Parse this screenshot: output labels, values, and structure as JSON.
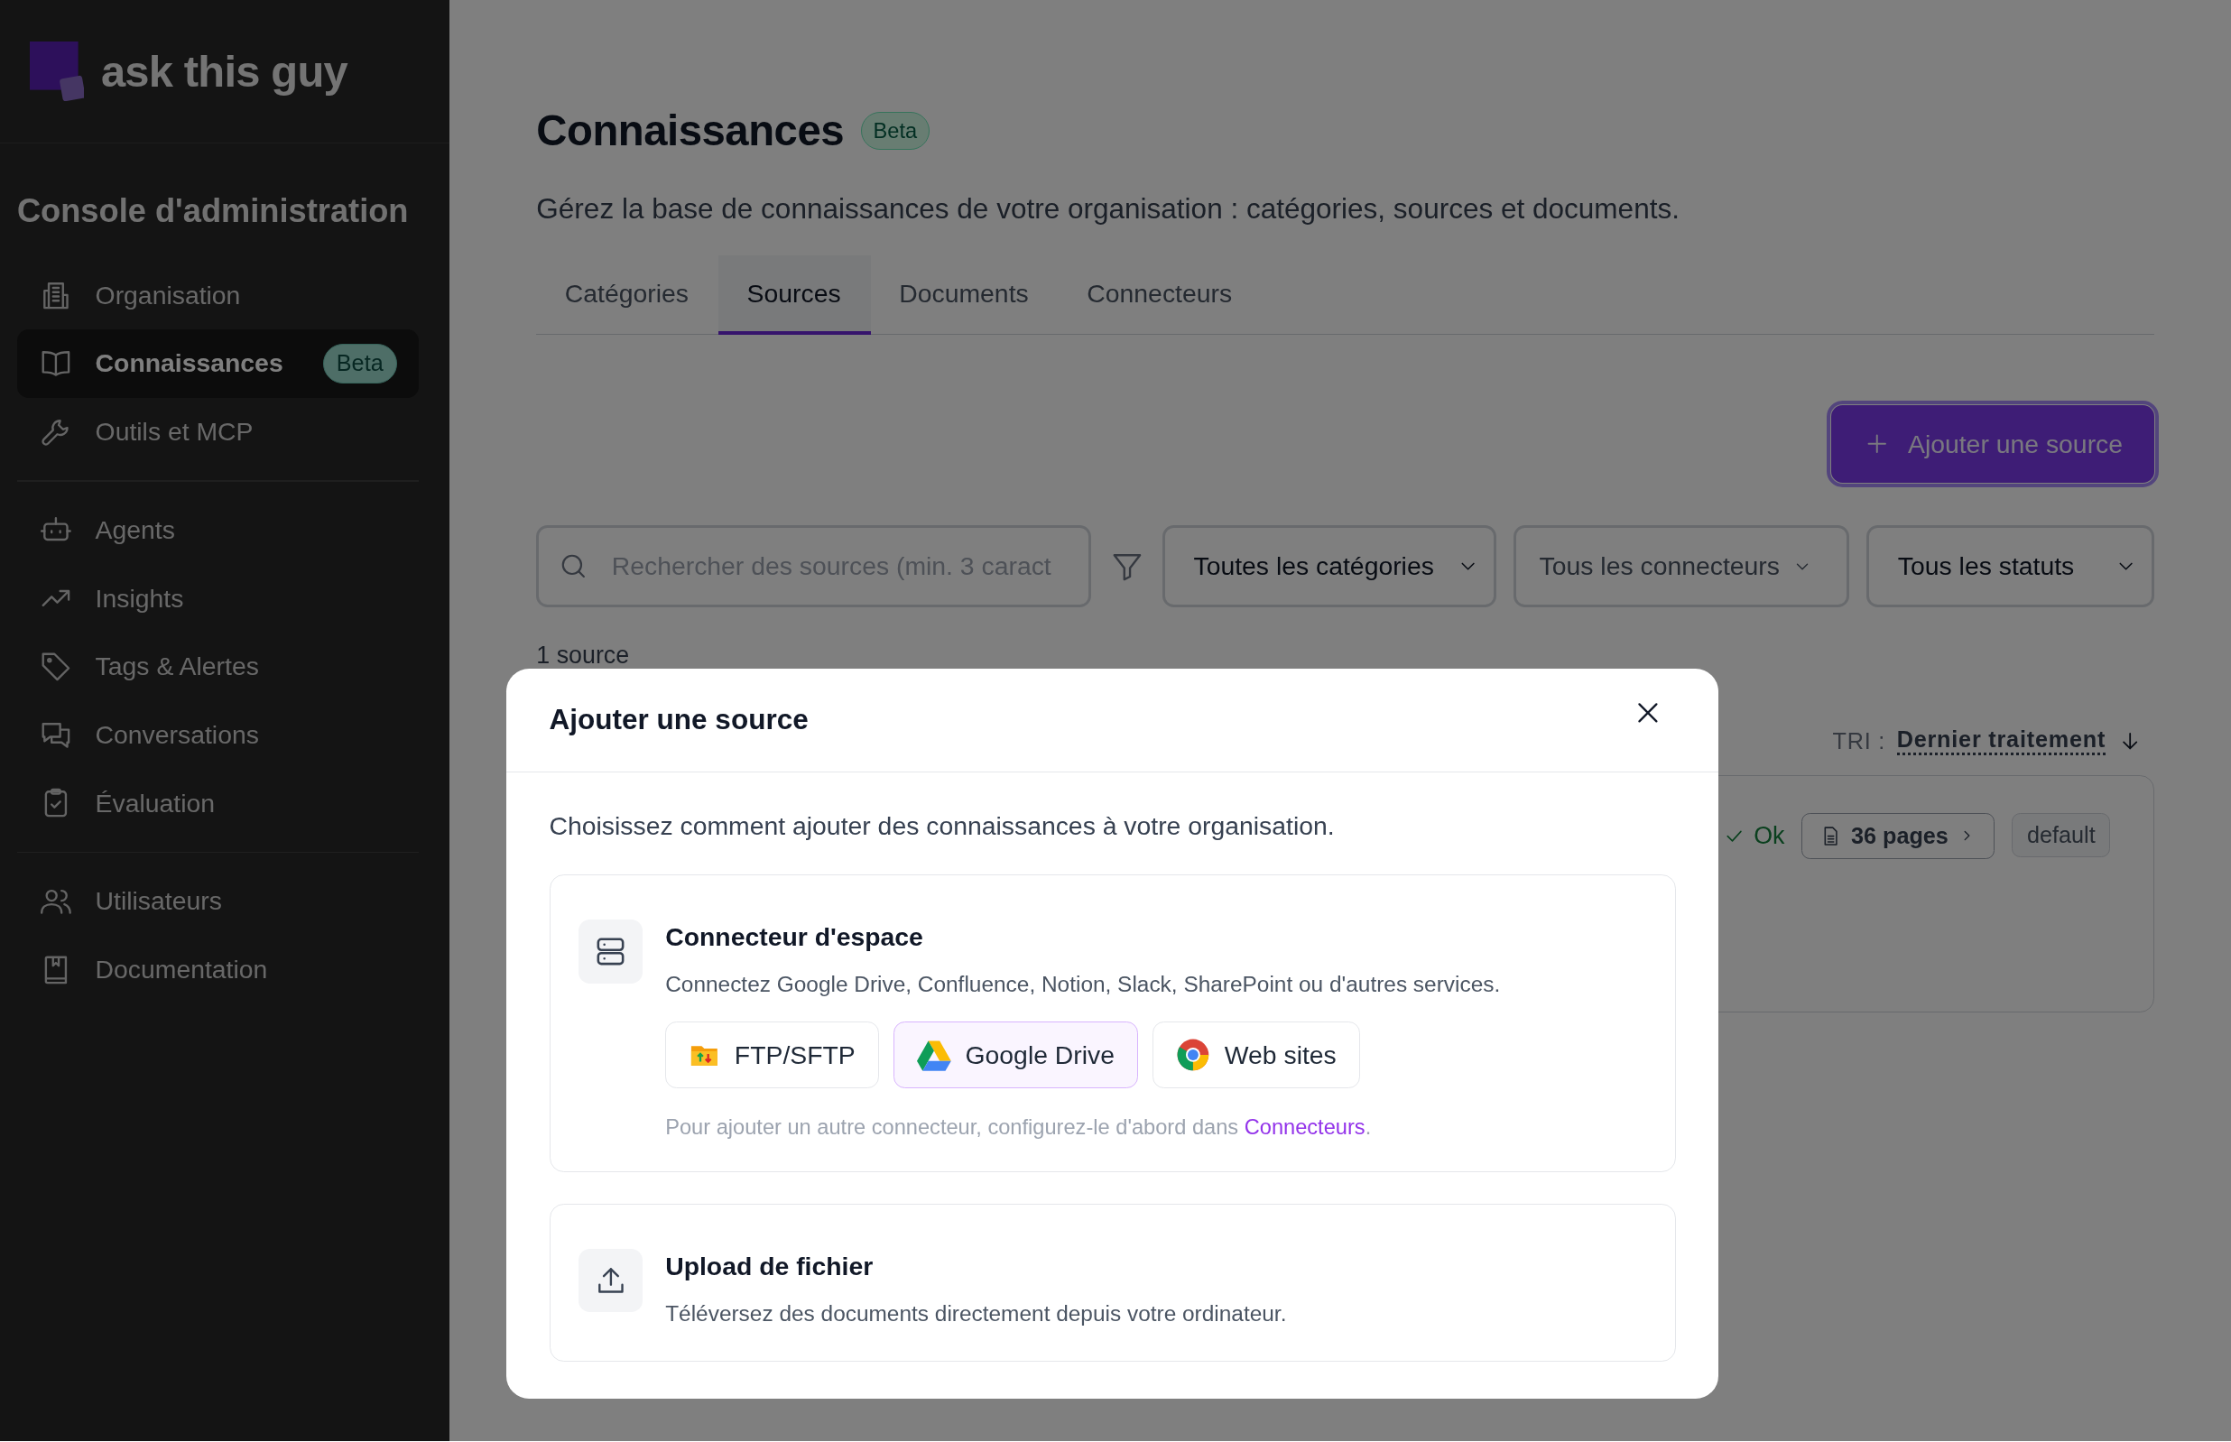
{
  "sidebar": {
    "logo_text": "ask this guy",
    "heading": "Console d'administration",
    "groups": [
      [
        {
          "label": "Organisation",
          "selected": false
        },
        {
          "label": "Connaissances",
          "selected": true,
          "badge": "Beta"
        },
        {
          "label": "Outils et MCP",
          "selected": false
        }
      ],
      [
        {
          "label": "Agents",
          "selected": false
        },
        {
          "label": "Insights",
          "selected": false
        },
        {
          "label": "Tags & Alertes",
          "selected": false
        },
        {
          "label": "Conversations",
          "selected": false
        },
        {
          "label": "Évaluation",
          "selected": false
        }
      ],
      [
        {
          "label": "Utilisateurs",
          "selected": false
        },
        {
          "label": "Documentation",
          "selected": false
        }
      ]
    ]
  },
  "page": {
    "title": "Connaissances",
    "badge": "Beta",
    "subtitle": "Gérez la base de connaissances de votre organisation : catégories, sources et documents.",
    "tabs": [
      {
        "label": "Catégories",
        "selected": false
      },
      {
        "label": "Sources",
        "selected": true
      },
      {
        "label": "Documents",
        "selected": false
      },
      {
        "label": "Connecteurs",
        "selected": false
      }
    ],
    "add_button": "Ajouter une source",
    "search": {
      "placeholder": "Rechercher des sources (min. 3 caract"
    },
    "filters": [
      {
        "kind": "select",
        "value": "Toutes les catégories"
      },
      {
        "kind": "combobox",
        "value": "Tous les connecteurs"
      },
      {
        "kind": "select",
        "value": "Tous les statuts"
      }
    ],
    "count": "1 source",
    "sort": {
      "label": "TRI :",
      "value": "Dernier traitement"
    },
    "source_row": {
      "status": "Ok",
      "pages": "36 pages",
      "tag": "default"
    }
  },
  "modal": {
    "title": "Ajouter une source",
    "intro": "Choisissez comment ajouter des connaissances à votre organisation.",
    "options": [
      {
        "kind": "connectors",
        "title": "Connecteur d'espace",
        "description": "Connectez Google Drive, Confluence, Notion, Slack, SharePoint ou d'autres services.",
        "connectors": [
          {
            "label": "FTP/SFTP",
            "selected": false
          },
          {
            "label": "Google Drive",
            "selected": true
          },
          {
            "label": "Web sites",
            "selected": false
          }
        ],
        "note": {
          "text": "Pour ajouter un autre connecteur, configurez-le d'abord dans ",
          "link": "Connecteurs",
          "end": "."
        }
      },
      {
        "kind": "upload",
        "title": "Upload de fichier",
        "description": "Téléversez des documents directement depuis votre ordinateur."
      }
    ]
  }
}
